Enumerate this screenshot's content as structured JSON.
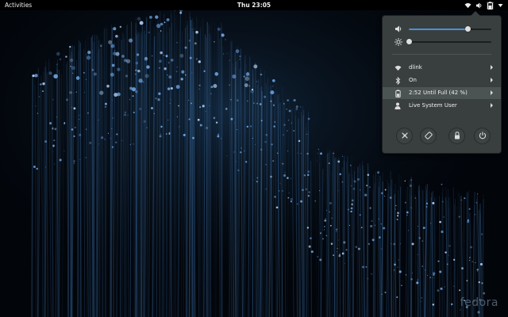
{
  "topbar": {
    "activities": "Activities",
    "clock": "Thu 23:05",
    "icons": [
      "wifi-icon",
      "volume-icon",
      "battery-icon",
      "dropdown-arrow-icon"
    ]
  },
  "menu": {
    "volume": {
      "icon": "volume-icon",
      "level": 0.72
    },
    "brightness": {
      "icon": "brightness-icon",
      "level": 0.0
    },
    "items": [
      {
        "icon": "wifi-icon",
        "label": "dlink"
      },
      {
        "icon": "bluetooth-icon",
        "label": "On"
      },
      {
        "icon": "battery-icon",
        "label": "2:52 Until Full (42 %)"
      },
      {
        "icon": "user-icon",
        "label": "Live System User"
      }
    ],
    "buttons": [
      "settings-icon",
      "rotation-lock-icon",
      "lock-icon",
      "power-icon"
    ],
    "accent": "#4a90d9"
  },
  "watermark": "fedora"
}
